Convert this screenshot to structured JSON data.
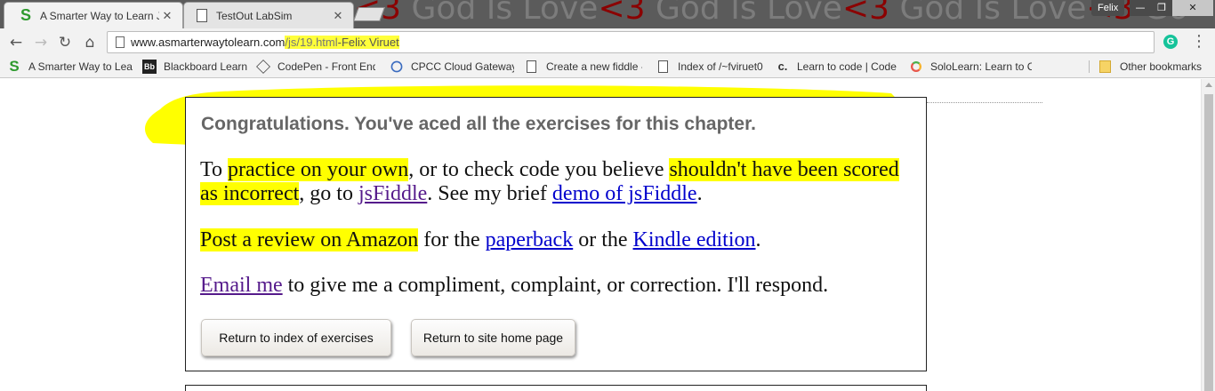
{
  "browser": {
    "tabs": [
      {
        "title": "A Smarter Way to Learn J"
      },
      {
        "title": "TestOut LabSim"
      }
    ],
    "banner": {
      "segments": [
        {
          "text": "<3",
          "type": "heart"
        },
        {
          "text": " God Is Love",
          "type": "text"
        },
        {
          "text": "<3",
          "type": "heart"
        },
        {
          "text": " God Is Love",
          "type": "text"
        },
        {
          "text": "<3",
          "type": "heart"
        },
        {
          "text": " God Is Love",
          "type": "text"
        },
        {
          "text": "<3",
          "type": "heart"
        },
        {
          "text": " Go",
          "type": "text"
        }
      ]
    },
    "user": "Felix",
    "window_controls": {
      "minimize": "—",
      "maximize": "❐",
      "close": "✕"
    },
    "address": {
      "host": "www.asmarterwaytolearn.com",
      "path": "/js/19.html",
      "note": "-Felix Viruet"
    },
    "extension_icon": "G",
    "bookmarks": [
      {
        "label": "A Smarter Way to Lea",
        "icon": "s-logo-icon"
      },
      {
        "label": "Blackboard Learn",
        "icon": "blackboard-icon",
        "glyph": "Bb"
      },
      {
        "label": "CodePen - Front End",
        "icon": "codepen-icon"
      },
      {
        "label": "CPCC Cloud Gateway",
        "icon": "cpcc-icon"
      },
      {
        "label": "Create a new fiddle -",
        "icon": "page-icon"
      },
      {
        "label": "Index of /~fviruet0",
        "icon": "page-icon"
      },
      {
        "label": "Learn to code | Code",
        "icon": "codecademy-icon",
        "glyph": "c."
      },
      {
        "label": "SoloLearn: Learn to C",
        "icon": "sololearn-icon"
      }
    ],
    "other_bookmarks": "Other bookmarks"
  },
  "page": {
    "congrats": "Congratulations. You've aced all the exercises for this chapter.",
    "p1": {
      "t1": "To ",
      "h1": "practice on your own",
      "t2": ", or to check code you believe ",
      "h2": "shouldn't have been scored as incorrect",
      "t3": ", go to ",
      "link1": "jsFiddle",
      "t4": ". See my brief ",
      "link2": "demo of jsFiddle",
      "t5": "."
    },
    "p2": {
      "h1": "Post a review on Amazon",
      "t1": " for the ",
      "link1": "paperback",
      "t2": " or the ",
      "link2": "Kindle edition",
      "t3": "."
    },
    "p3": {
      "link1": "Email me",
      "t1": " to give me a compliment, complaint, or correction. I'll respond."
    },
    "buttons": {
      "index": "Return to index of exercises",
      "home": "Return to site home page"
    }
  },
  "colors": {
    "highlighter": "#ffff00",
    "link": "#0000cc",
    "visited_link": "#551a8b",
    "banner_heart": "#8b0000"
  }
}
